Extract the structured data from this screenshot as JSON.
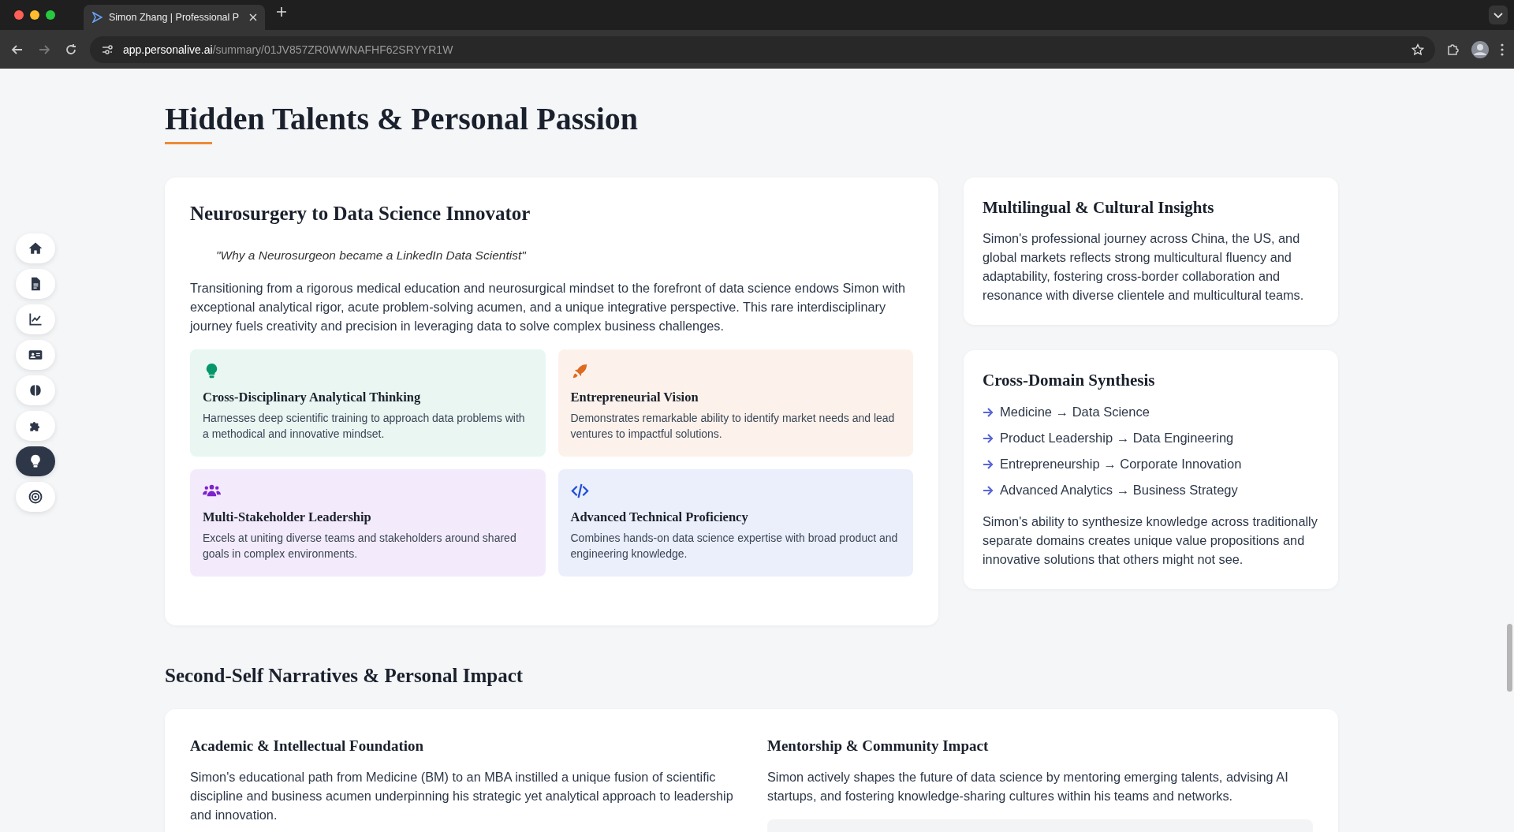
{
  "browser": {
    "tab_title": "Simon Zhang | Professional P",
    "url_host": "app.personalive.ai",
    "url_path": "/summary/01JV857ZR0WWNAFHF62SRYYR1W"
  },
  "sidebar": {
    "items": [
      {
        "kind": "home",
        "selected": false
      },
      {
        "kind": "document",
        "selected": false
      },
      {
        "kind": "chart",
        "selected": false
      },
      {
        "kind": "id-card",
        "selected": false
      },
      {
        "kind": "brain",
        "selected": false
      },
      {
        "kind": "puzzle",
        "selected": false
      },
      {
        "kind": "bulb",
        "selected": true
      },
      {
        "kind": "target",
        "selected": false
      }
    ]
  },
  "section_title": "Hidden Talents & Personal Passion",
  "main_card": {
    "title": "Neurosurgery to Data Science Innovator",
    "quote": "\"Why a Neurosurgeon became a LinkedIn Data Scientist\"",
    "body": "Transitioning from a rigorous medical education and neurosurgical mindset to the forefront of data science endows Simon with exceptional analytical rigor, acute problem-solving acumen, and a unique integrative perspective. This rare interdisciplinary journey fuels creativity and precision in leveraging data to solve complex business challenges.",
    "tiles": [
      {
        "kind": "bulb",
        "color": "#059669",
        "title": "Cross-Disciplinary Analytical Thinking",
        "text": "Harnesses deep scientific training to approach data problems with a methodical and innovative mindset."
      },
      {
        "kind": "rocket",
        "color": "#dd6b20",
        "title": "Entrepreneurial Vision",
        "text": "Demonstrates remarkable ability to identify market needs and lead ventures to impactful solutions."
      },
      {
        "kind": "users",
        "color": "#7e22ce",
        "title": "Multi-Stakeholder Leadership",
        "text": "Excels at uniting diverse teams and stakeholders around shared goals in complex environments."
      },
      {
        "kind": "code",
        "color": "#1d4ed8",
        "title": "Advanced Technical Proficiency",
        "text": "Combines hands-on data science expertise with broad product and engineering knowledge."
      }
    ]
  },
  "multilingual_card": {
    "title": "Multilingual & Cultural Insights",
    "body": "Simon's professional journey across China, the US, and global markets reflects strong multicultural fluency and adaptability, fostering cross-border collaboration and resonance with diverse clientele and multicultural teams."
  },
  "synthesis_card": {
    "title": "Cross-Domain Synthesis",
    "items": [
      "Medicine → Data Science",
      "Product Leadership → Data Engineering",
      "Entrepreneurship → Corporate Innovation",
      "Advanced Analytics → Business Strategy"
    ],
    "body": "Simon's ability to synthesize knowledge across traditionally separate domains creates unique value propositions and innovative solutions that others might not see."
  },
  "second_section": {
    "title": "Second-Self Narratives & Personal Impact",
    "columns": [
      {
        "title": "Academic & Intellectual Foundation",
        "body": "Simon's educational path from Medicine (BM) to an MBA instilled a unique fusion of scientific discipline and business acumen underpinning his strategic yet analytical approach to leadership and innovation."
      },
      {
        "title": "Mentorship & Community Impact",
        "body": "Simon actively shapes the future of data science by mentoring emerging talents, advising AI startups, and fostering knowledge-sharing cultures within his teams and networks.",
        "has_panel": true
      }
    ]
  }
}
